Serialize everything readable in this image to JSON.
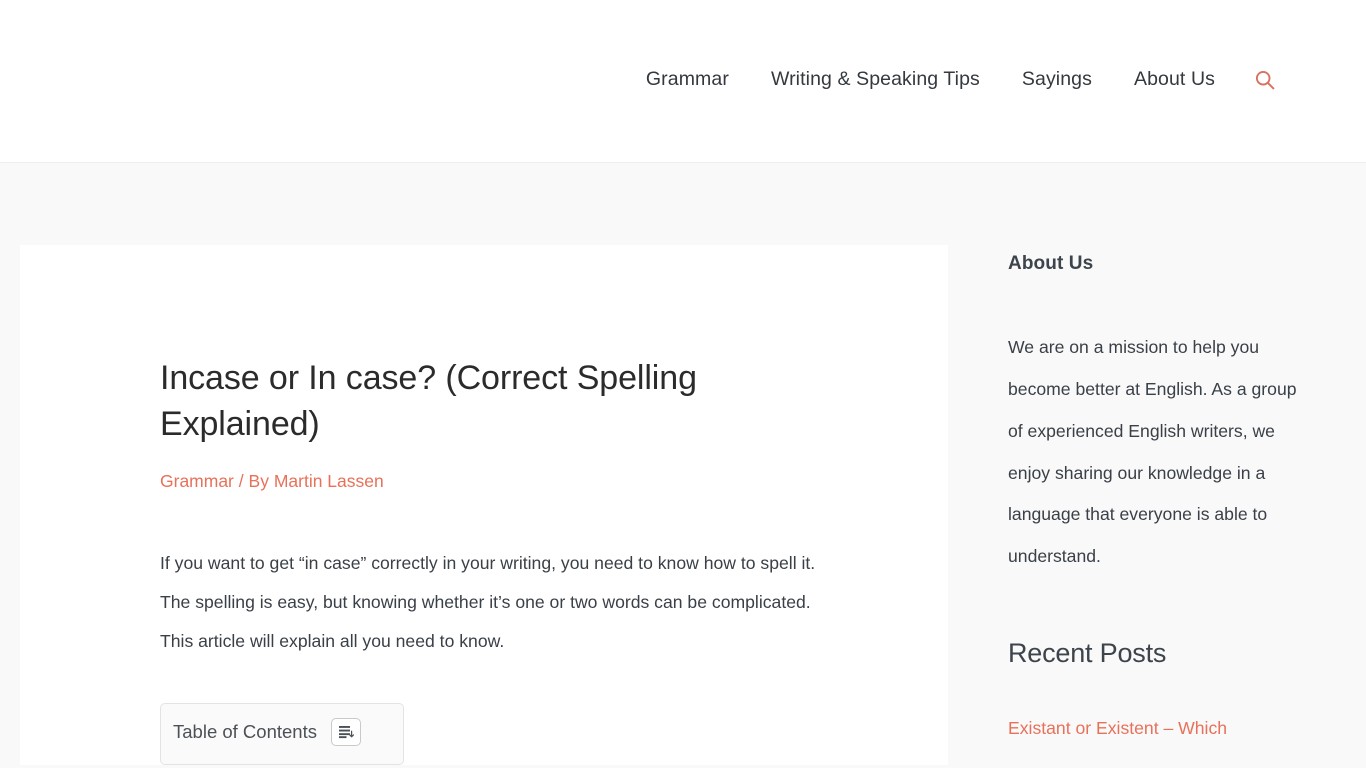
{
  "header": {
    "nav_items": [
      {
        "label": "Grammar"
      },
      {
        "label": "Writing & Speaking Tips"
      },
      {
        "label": "Sayings"
      },
      {
        "label": "About Us"
      }
    ],
    "search_icon": "search-icon"
  },
  "article": {
    "title": "Incase or In case? (Correct Spelling Explained)",
    "category": "Grammar",
    "meta_separator": "/",
    "byline_prefix": "By",
    "author": "Martin Lassen",
    "intro": "If you want to get “in case” correctly in your writing, you need to know how to spell it. The spelling is easy, but knowing whether it’s one or two words can be complicated. This article will explain all you need to know.",
    "toc": {
      "title": "Table of Contents",
      "toggle_icon": "list-toggle-icon"
    }
  },
  "sidebar": {
    "about": {
      "title": "About Us",
      "text": "We are on a mission to help you become better at English. As a group of experienced English writers, we enjoy sharing our knowledge in a language that everyone is able to understand."
    },
    "recent": {
      "title": "Recent Posts",
      "posts": [
        {
          "label": "Existant or Existent – Which"
        }
      ]
    }
  },
  "colors": {
    "accent": "#e8715a",
    "text": "#3a4047",
    "heading": "#2b2b2b",
    "nav_text": "#33393f",
    "page_bg": "#f9f9f9",
    "card_bg": "#ffffff"
  }
}
